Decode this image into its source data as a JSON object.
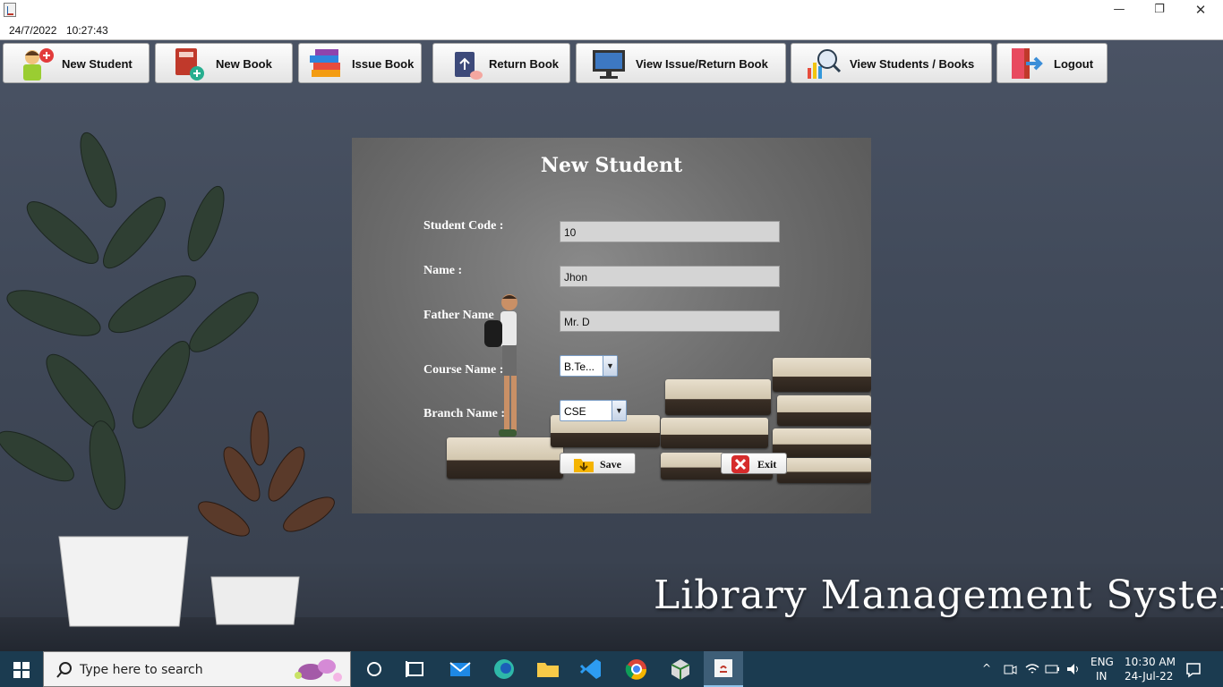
{
  "window": {
    "minimize_glyph": "—",
    "maximize_glyph": "❐",
    "close_glyph": "✕"
  },
  "status": {
    "date": "24/7/2022",
    "time": "10:27:43"
  },
  "toolbar": [
    {
      "label": "New Student",
      "icon": "add-student-icon"
    },
    {
      "label": "New Book",
      "icon": "add-book-icon"
    },
    {
      "label": "Issue Book",
      "icon": "book-stack-icon"
    },
    {
      "label": "Return Book",
      "icon": "return-book-icon"
    },
    {
      "label": "View Issue/Return Book",
      "icon": "monitor-icon"
    },
    {
      "label": "View Students / Books",
      "icon": "magnifier-chart-icon"
    },
    {
      "label": "Logout",
      "icon": "logout-door-icon"
    }
  ],
  "form": {
    "title": "New Student",
    "student_code_label": "Student Code :",
    "student_code_value": "10",
    "name_label": "Name :",
    "name_value": "Jhon",
    "father_name_label": "Father Name",
    "father_name_value": "Mr. D",
    "course_label": "Course Name :",
    "course_value": "B.Te...",
    "branch_label": "Branch Name :",
    "branch_value": "CSE",
    "save_label": "Save",
    "exit_label": "Exit"
  },
  "brand": "Library Management System.",
  "taskbar": {
    "search_placeholder": "Type here to search",
    "language_1": "ENG",
    "language_2": "IN",
    "time": "10:30 AM",
    "date": "24-Jul-22"
  },
  "colors": {
    "accent_blue": "#1f5fa8",
    "save_icon": "#f5b400",
    "exit_icon": "#d62b2b",
    "taskbar": "#1b3b50"
  }
}
